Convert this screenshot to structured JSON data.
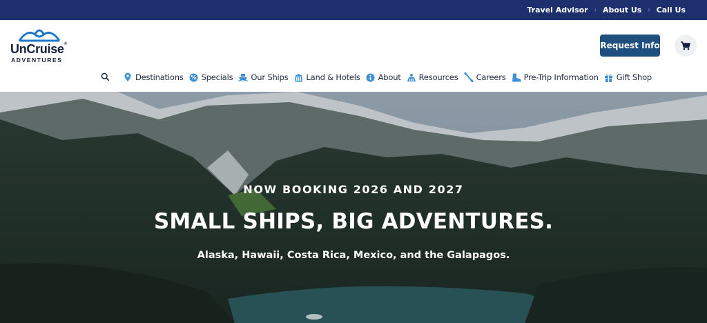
{
  "topbar": {
    "links": [
      "Travel Advisor",
      "About Us",
      "Call Us"
    ]
  },
  "header": {
    "logo": {
      "name": "UnCruise",
      "tm": "®",
      "sub": "ADVENTURES"
    },
    "request_info_label": "Request Info"
  },
  "nav": {
    "items": [
      {
        "label": "Destinations",
        "icon": "map-pin-icon"
      },
      {
        "label": "Specials",
        "icon": "percent-badge-icon"
      },
      {
        "label": "Our Ships",
        "icon": "ship-icon"
      },
      {
        "label": "Land & Hotels",
        "icon": "hotel-icon"
      },
      {
        "label": "About",
        "icon": "info-icon"
      },
      {
        "label": "Resources",
        "icon": "resources-icon"
      },
      {
        "label": "Careers",
        "icon": "careers-icon"
      },
      {
        "label": "Pre-Trip Information",
        "icon": "boot-icon"
      },
      {
        "label": "Gift Shop",
        "icon": "gift-icon"
      }
    ]
  },
  "hero": {
    "kicker": "NOW BOOKING 2026 AND 2027",
    "headline": "SMALL SHIPS, BIG ADVENTURES.",
    "subline": "Alaska, Hawaii, Costa Rica, Mexico, and the Galapagos."
  },
  "colors": {
    "topbar": "#1e2f6e",
    "button": "#1e4f7e",
    "nav_icon": "#3d8fd6"
  }
}
